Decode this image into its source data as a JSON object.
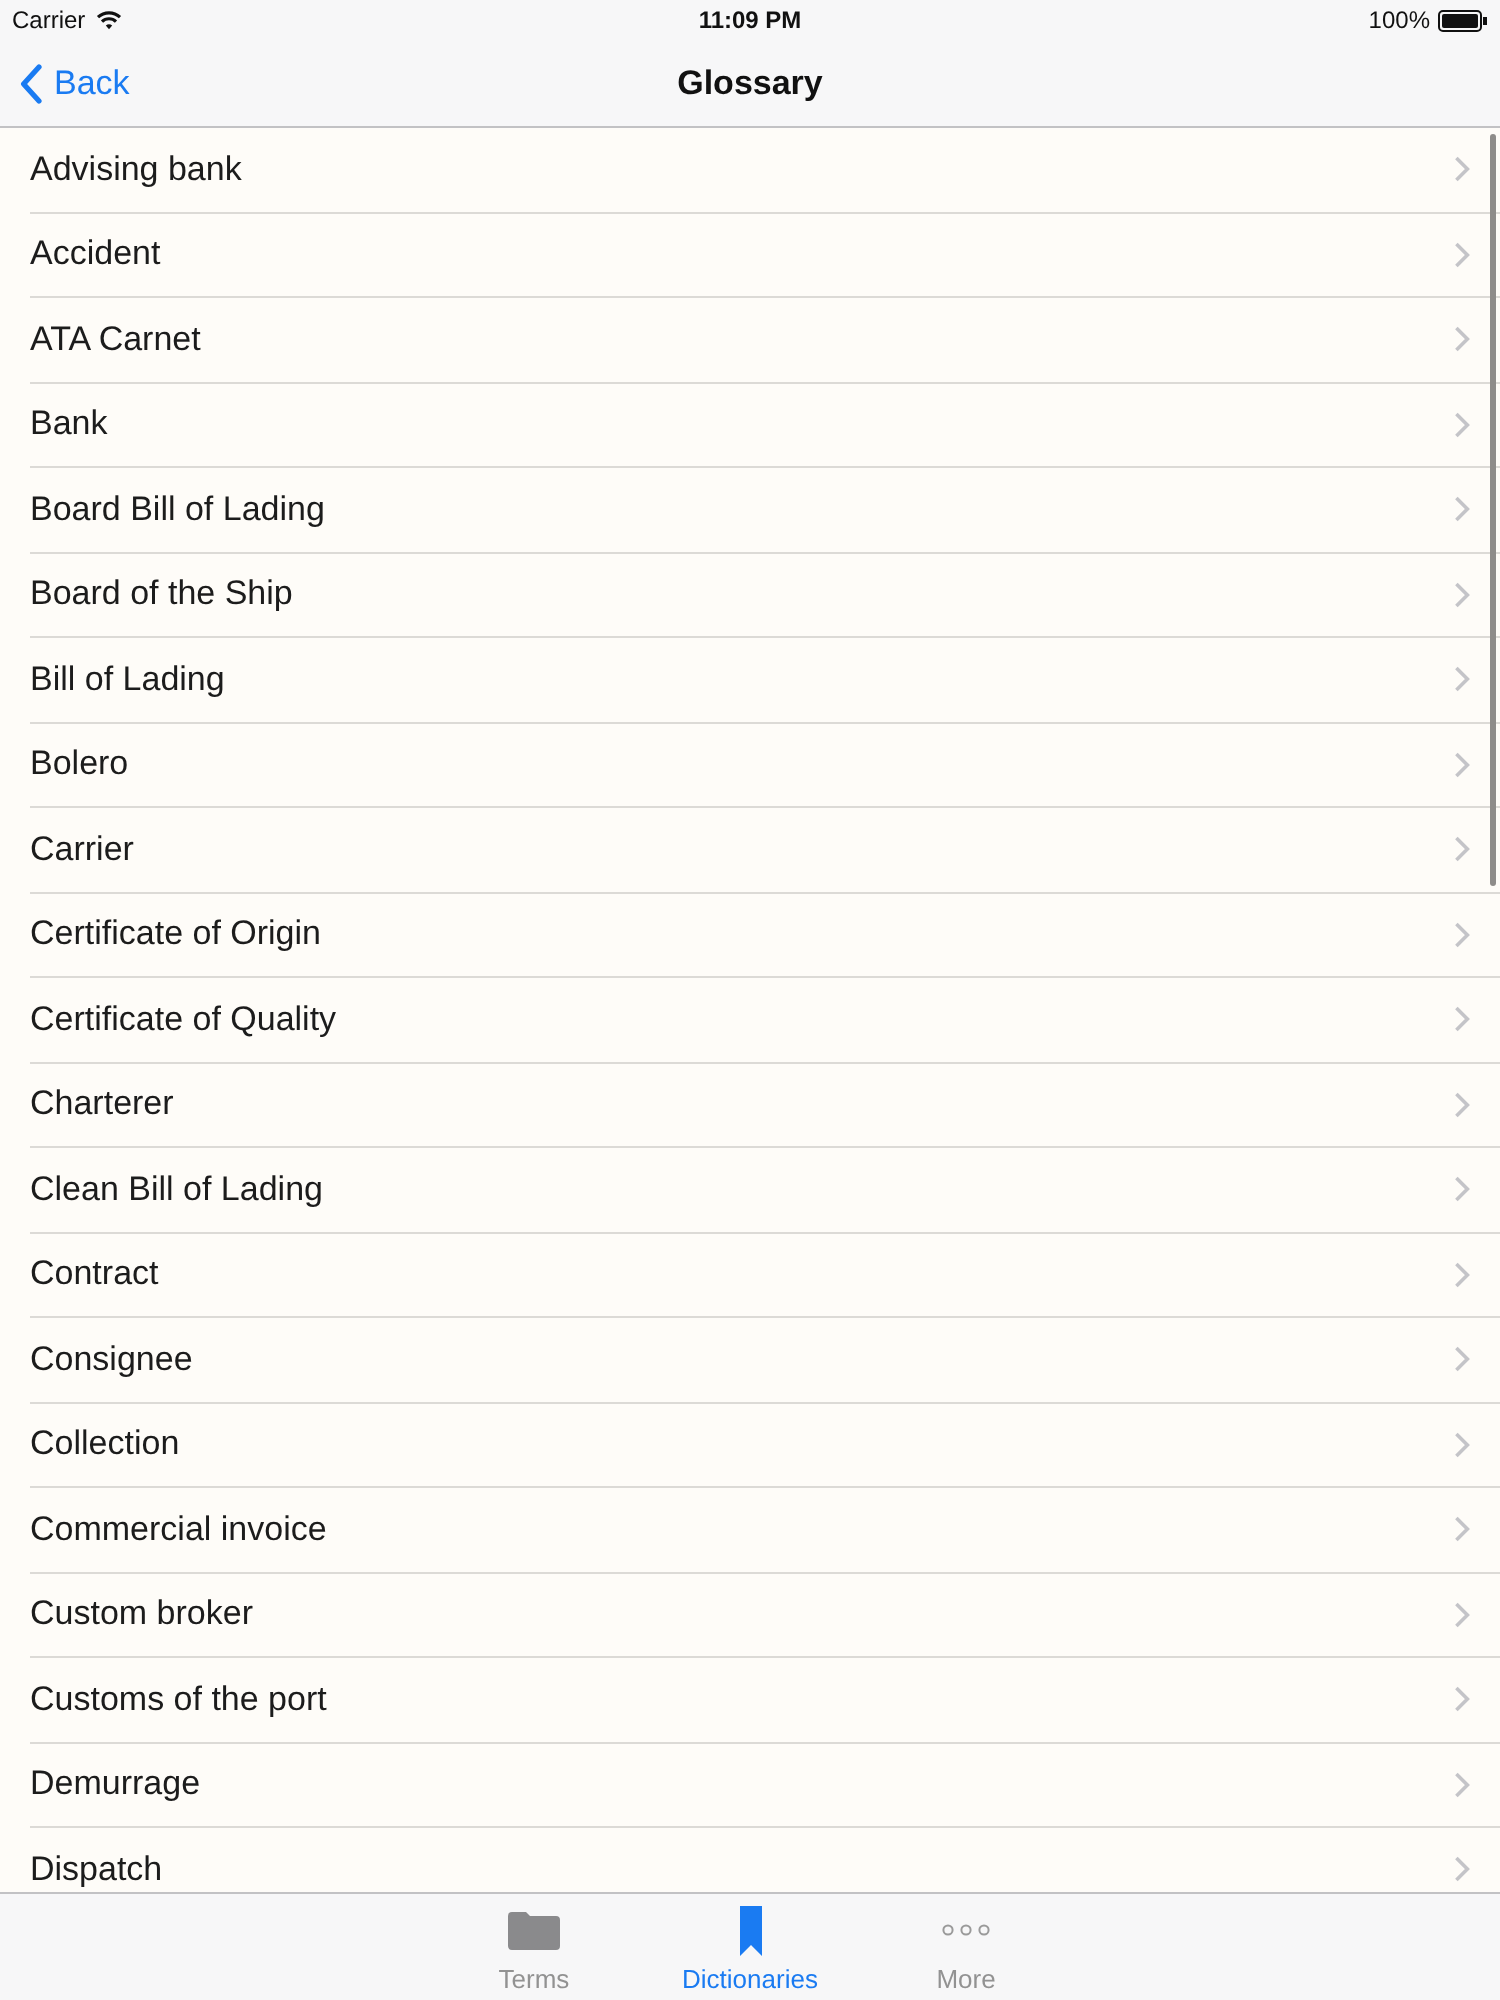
{
  "status_bar": {
    "carrier": "Carrier",
    "time": "11:09 PM",
    "battery": "100%"
  },
  "nav_bar": {
    "back": "Back",
    "title": "Glossary"
  },
  "list": {
    "items": [
      "Advising bank",
      "Accident",
      "ATA Carnet",
      "Bank",
      "Board Bill of Lading",
      "Board of the Ship",
      "Bill of Lading",
      "Bolero",
      "Carrier",
      "Certificate of Origin",
      "Certificate of Quality",
      "Charterer",
      "Clean Bill of Lading",
      "Contract",
      "Consignee",
      "Collection",
      "Commercial invoice",
      "Custom broker",
      "Customs of the port",
      "Demurrage",
      "Dispatch"
    ]
  },
  "tab_bar": {
    "tabs": [
      {
        "label": "Terms",
        "selected": false
      },
      {
        "label": "Dictionaries",
        "selected": true
      },
      {
        "label": "More",
        "selected": false
      }
    ]
  }
}
